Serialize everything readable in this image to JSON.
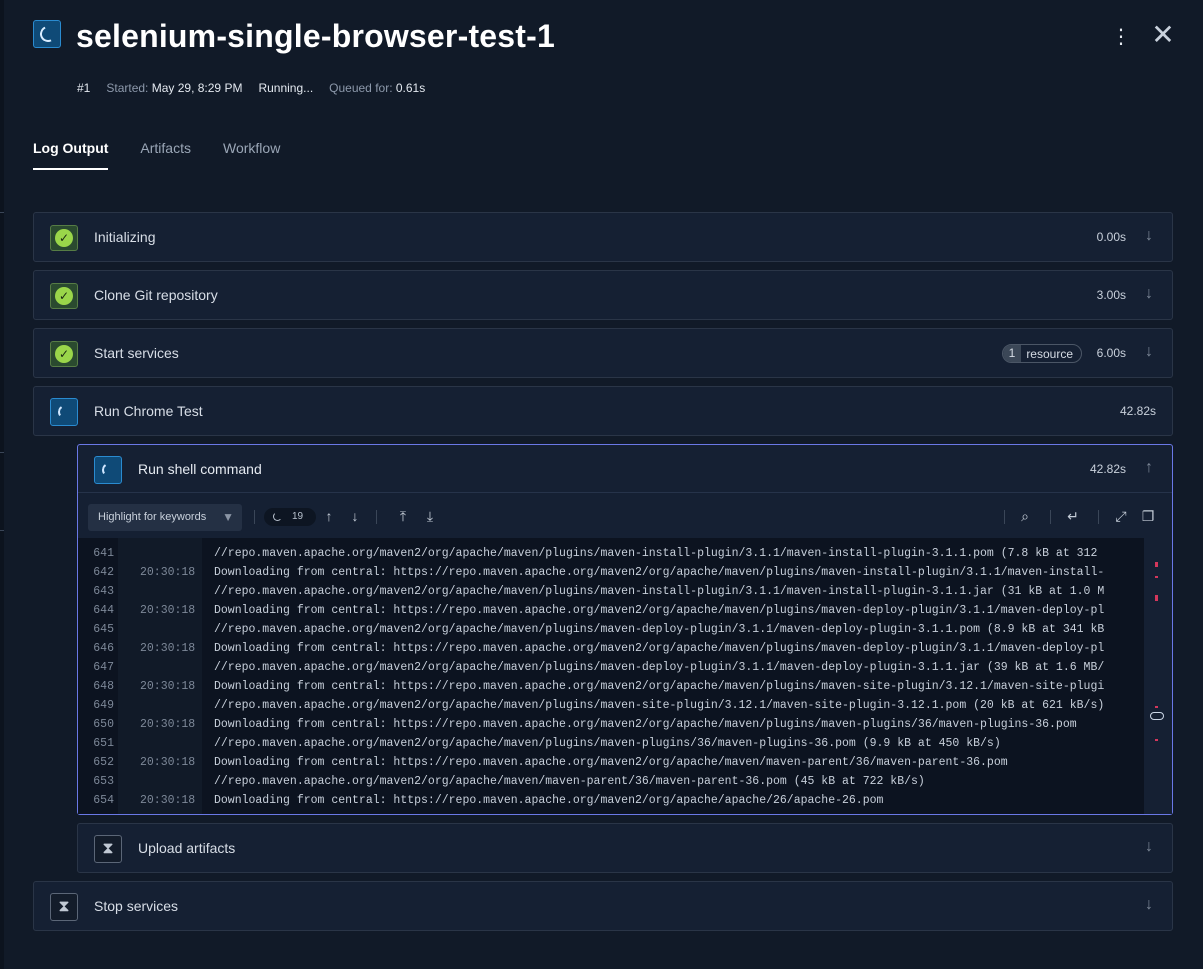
{
  "header": {
    "title": "selenium-single-browser-test-1",
    "run_number": "#1",
    "started_label": "Started:",
    "started_value": "May 29, 8:29 PM",
    "status": "Running...",
    "queued_label": "Queued for:",
    "queued_value": "0.61s"
  },
  "tabs": [
    {
      "label": "Log Output",
      "active": true
    },
    {
      "label": "Artifacts",
      "active": false
    },
    {
      "label": "Workflow",
      "active": false
    }
  ],
  "steps": {
    "initializing": {
      "label": "Initializing",
      "duration": "0.00s",
      "status": "success"
    },
    "clone": {
      "label": "Clone Git repository",
      "duration": "3.00s",
      "status": "success"
    },
    "services": {
      "label": "Start services",
      "duration": "6.00s",
      "status": "success",
      "resource_count": "1",
      "resource_label": "resource"
    },
    "chrome": {
      "label": "Run Chrome Test",
      "duration": "42.82s",
      "status": "running"
    },
    "shell": {
      "label": "Run shell command",
      "duration": "42.82s",
      "status": "running"
    },
    "upload": {
      "label": "Upload artifacts",
      "status": "waiting"
    },
    "stop": {
      "label": "Stop services",
      "status": "waiting"
    }
  },
  "log_toolbar": {
    "keyword_placeholder": "Highlight for keywords",
    "match_count": "19"
  },
  "log_lines": [
    {
      "n": "641",
      "t": "",
      "text": "//repo.maven.apache.org/maven2/org/apache/maven/plugins/maven-install-plugin/3.1.1/maven-install-plugin-3.1.1.pom (7.8 kB at 312"
    },
    {
      "n": "642",
      "t": "20:30:18",
      "text": "Downloading from central: https://repo.maven.apache.org/maven2/org/apache/maven/plugins/maven-install-plugin/3.1.1/maven-install-"
    },
    {
      "n": "643",
      "t": "",
      "text": "//repo.maven.apache.org/maven2/org/apache/maven/plugins/maven-install-plugin/3.1.1/maven-install-plugin-3.1.1.jar (31 kB at 1.0 M"
    },
    {
      "n": "644",
      "t": "20:30:18",
      "text": "Downloading from central: https://repo.maven.apache.org/maven2/org/apache/maven/plugins/maven-deploy-plugin/3.1.1/maven-deploy-pl"
    },
    {
      "n": "645",
      "t": "",
      "text": "//repo.maven.apache.org/maven2/org/apache/maven/plugins/maven-deploy-plugin/3.1.1/maven-deploy-plugin-3.1.1.pom (8.9 kB at 341 kB"
    },
    {
      "n": "646",
      "t": "20:30:18",
      "text": "Downloading from central: https://repo.maven.apache.org/maven2/org/apache/maven/plugins/maven-deploy-plugin/3.1.1/maven-deploy-pl"
    },
    {
      "n": "647",
      "t": "",
      "text": "//repo.maven.apache.org/maven2/org/apache/maven/plugins/maven-deploy-plugin/3.1.1/maven-deploy-plugin-3.1.1.jar (39 kB at 1.6 MB/"
    },
    {
      "n": "648",
      "t": "20:30:18",
      "text": "Downloading from central: https://repo.maven.apache.org/maven2/org/apache/maven/plugins/maven-site-plugin/3.12.1/maven-site-plugi"
    },
    {
      "n": "649",
      "t": "",
      "text": "//repo.maven.apache.org/maven2/org/apache/maven/plugins/maven-site-plugin/3.12.1/maven-site-plugin-3.12.1.pom (20 kB at 621 kB/s)"
    },
    {
      "n": "650",
      "t": "20:30:18",
      "text": "Downloading from central: https://repo.maven.apache.org/maven2/org/apache/maven/plugins/maven-plugins/36/maven-plugins-36.pom"
    },
    {
      "n": "651",
      "t": "",
      "text": "//repo.maven.apache.org/maven2/org/apache/maven/plugins/maven-plugins/36/maven-plugins-36.pom (9.9 kB at 450 kB/s)"
    },
    {
      "n": "652",
      "t": "20:30:18",
      "text": "Downloading from central: https://repo.maven.apache.org/maven2/org/apache/maven/maven-parent/36/maven-parent-36.pom"
    },
    {
      "n": "653",
      "t": "",
      "text": "//repo.maven.apache.org/maven2/org/apache/maven/maven-parent/36/maven-parent-36.pom (45 kB at 722 kB/s)"
    },
    {
      "n": "654",
      "t": "20:30:18",
      "text": "Downloading from central: https://repo.maven.apache.org/maven2/org/apache/apache/26/apache-26.pom"
    }
  ],
  "colors": {
    "background": "#111a28",
    "success": "#9ad64a",
    "running": "#2a8bd0",
    "focus_border": "#6a78e6",
    "minimap_mark": "#d4375c"
  },
  "icons": {
    "kebab": "vertical-ellipsis-icon",
    "close": "close-icon",
    "success": "check-circle-icon",
    "running": "spinner-icon",
    "waiting": "hourglass-icon",
    "expand": "arrow-down-icon",
    "collapse": "arrow-up-icon"
  }
}
